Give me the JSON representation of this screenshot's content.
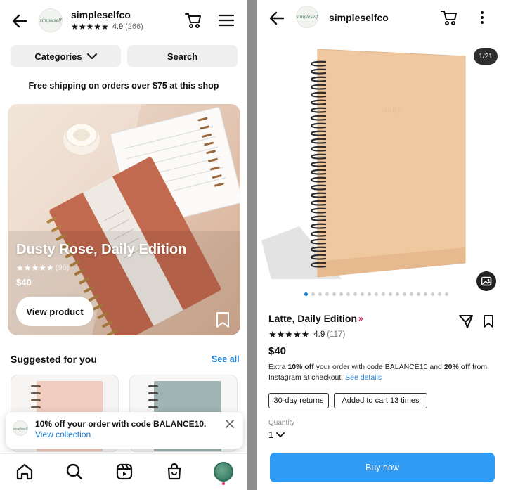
{
  "left": {
    "header": {
      "shop_name": "simpleselfco",
      "avatar_text": "simpleself",
      "stars": "★★★★★",
      "rating": "4.9",
      "rating_count": "(266)"
    },
    "filters": {
      "categories_label": "Categories",
      "search_label": "Search"
    },
    "shipping_note": "Free shipping on orders over $75 at this shop",
    "hero": {
      "title": "Dusty Rose, Daily Edition",
      "stars": "★★★★★",
      "rating_count": "(96)",
      "price": "$40",
      "cta_label": "View product"
    },
    "suggested": {
      "title": "Suggested for you",
      "see_all": "See all"
    },
    "toast": {
      "message": "10% off your order with code BALANCE10.",
      "link_text": "View collection"
    },
    "tabs": [
      "home-icon",
      "search-icon",
      "reels-icon",
      "shop-icon",
      "profile-avatar"
    ]
  },
  "right": {
    "header": {
      "shop_name": "simpleselfco",
      "avatar_text": "simpleself"
    },
    "image_counter": "1/21",
    "carousel": {
      "count": 21,
      "active_index": 0
    },
    "product": {
      "title": "Latte, Daily Edition",
      "title_suffix": "»",
      "stars": "★★★★★",
      "rating": "4.9",
      "rating_count": "(117)",
      "price": "$40",
      "promo_prefix": "Extra ",
      "promo_bold_1": "10% off",
      "promo_mid": " your order with code BALANCE10 and ",
      "promo_bold_2": "20% off",
      "promo_suffix": " from Instagram at checkout. ",
      "promo_link": "See details",
      "chip_returns": "30-day returns",
      "chip_cart": "Added to cart 13 times",
      "quantity_label": "Quantity",
      "quantity_value": "1",
      "buy_label": "Buy now"
    }
  },
  "colors": {
    "accent_blue": "#1d7ed0",
    "buy_button": "#2f9bf4",
    "notebook_latte": "#f0c8a0",
    "notebook_rose": "#c26a4f",
    "divider": "#8d8d8d"
  }
}
